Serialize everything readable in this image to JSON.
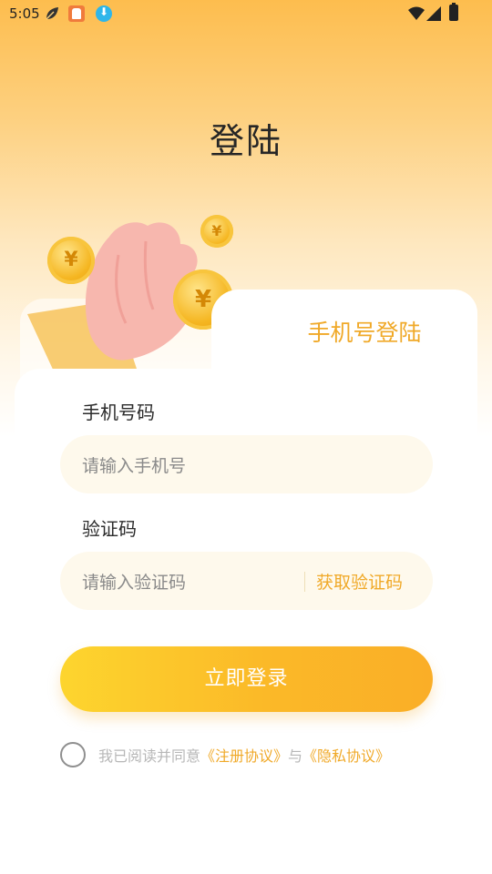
{
  "status_bar": {
    "time": "5:05"
  },
  "page": {
    "title": "登陆"
  },
  "card": {
    "tab_label": "手机号登陆"
  },
  "phone": {
    "label": "手机号码",
    "placeholder": "请输入手机号",
    "value": ""
  },
  "code": {
    "label": "验证码",
    "placeholder": "请输入验证码",
    "value": "",
    "get_code_label": "获取验证码"
  },
  "login_button": {
    "label": "立即登录"
  },
  "agreement": {
    "checked": false,
    "prefix": "我已阅读并同意",
    "register_link": "《注册协议》",
    "connector": "与",
    "privacy_link": "《隐私协议》"
  },
  "illustration": {
    "coin_symbol": "¥"
  },
  "colors": {
    "accent": "#f0a928",
    "button_start": "#fdd52e",
    "button_end": "#faae27",
    "input_bg": "#fef9ec"
  }
}
